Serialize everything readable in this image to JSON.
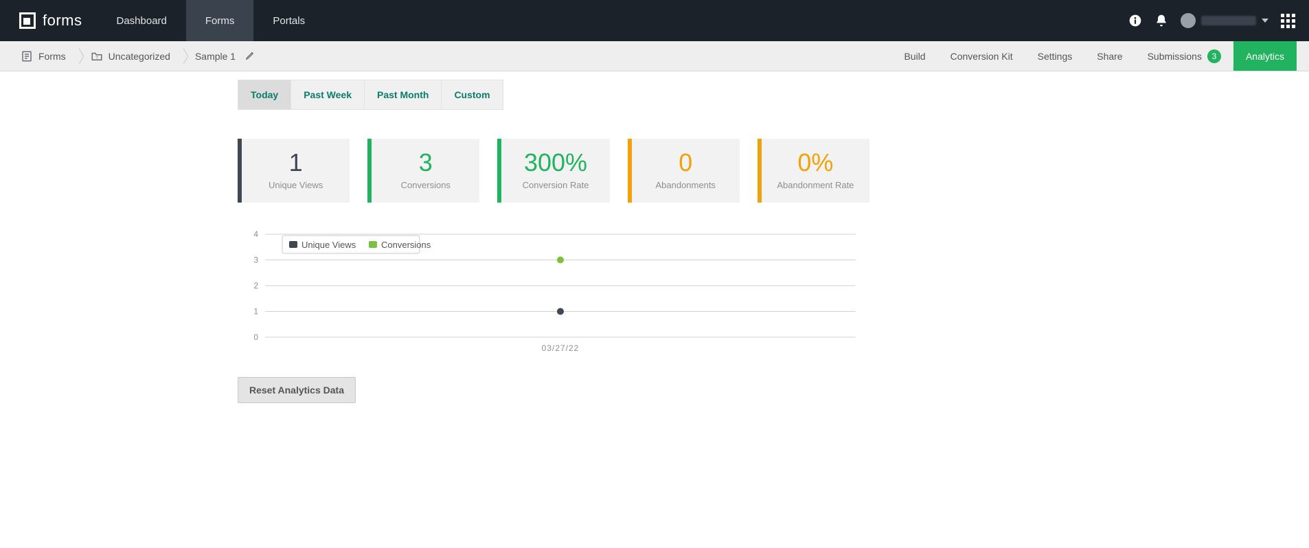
{
  "brand": {
    "name": "forms"
  },
  "topnav": {
    "items": [
      {
        "label": "Dashboard",
        "active": false
      },
      {
        "label": "Forms",
        "active": true
      },
      {
        "label": "Portals",
        "active": false
      }
    ]
  },
  "breadcrumb": {
    "items": [
      {
        "label": "Forms",
        "icon": "form-icon"
      },
      {
        "label": "Uncategorized",
        "icon": "folder-icon"
      },
      {
        "label": "Sample 1",
        "icon": null,
        "editable": true
      }
    ]
  },
  "subtabs": {
    "items": [
      {
        "label": "Build"
      },
      {
        "label": "Conversion Kit"
      },
      {
        "label": "Settings"
      },
      {
        "label": "Share"
      },
      {
        "label": "Submissions",
        "badge": "3"
      },
      {
        "label": "Analytics",
        "active": true
      }
    ]
  },
  "range_tabs": {
    "items": [
      {
        "label": "Today",
        "active": true
      },
      {
        "label": "Past Week"
      },
      {
        "label": "Past Month"
      },
      {
        "label": "Custom"
      }
    ]
  },
  "cards": [
    {
      "value": "1",
      "label": "Unique Views",
      "accent": "#3d4852",
      "value_color": "#3d4852"
    },
    {
      "value": "3",
      "label": "Conversions",
      "accent": "#21b35f",
      "value_color": "#21b35f"
    },
    {
      "value": "300%",
      "label": "Conversion Rate",
      "accent": "#21b35f",
      "value_color": "#21b35f"
    },
    {
      "value": "0",
      "label": "Abandonments",
      "accent": "#f1a10a",
      "value_color": "#f1a10a"
    },
    {
      "value": "0%",
      "label": "Abandonment Rate",
      "accent": "#f1a10a",
      "value_color": "#f1a10a"
    }
  ],
  "chart_data": {
    "type": "line",
    "x": [
      "03/27/22"
    ],
    "series": [
      {
        "name": "Unique Views",
        "values": [
          1
        ],
        "color": "#3d4852"
      },
      {
        "name": "Conversions",
        "values": [
          3
        ],
        "color": "#7cc142"
      }
    ],
    "ylim": [
      0,
      4
    ],
    "yticks": [
      0,
      1,
      2,
      3,
      4
    ],
    "ylabel": "",
    "xlabel": "",
    "legend_position": "top-left",
    "grid": true
  },
  "reset_button": {
    "label": "Reset Analytics Data"
  }
}
